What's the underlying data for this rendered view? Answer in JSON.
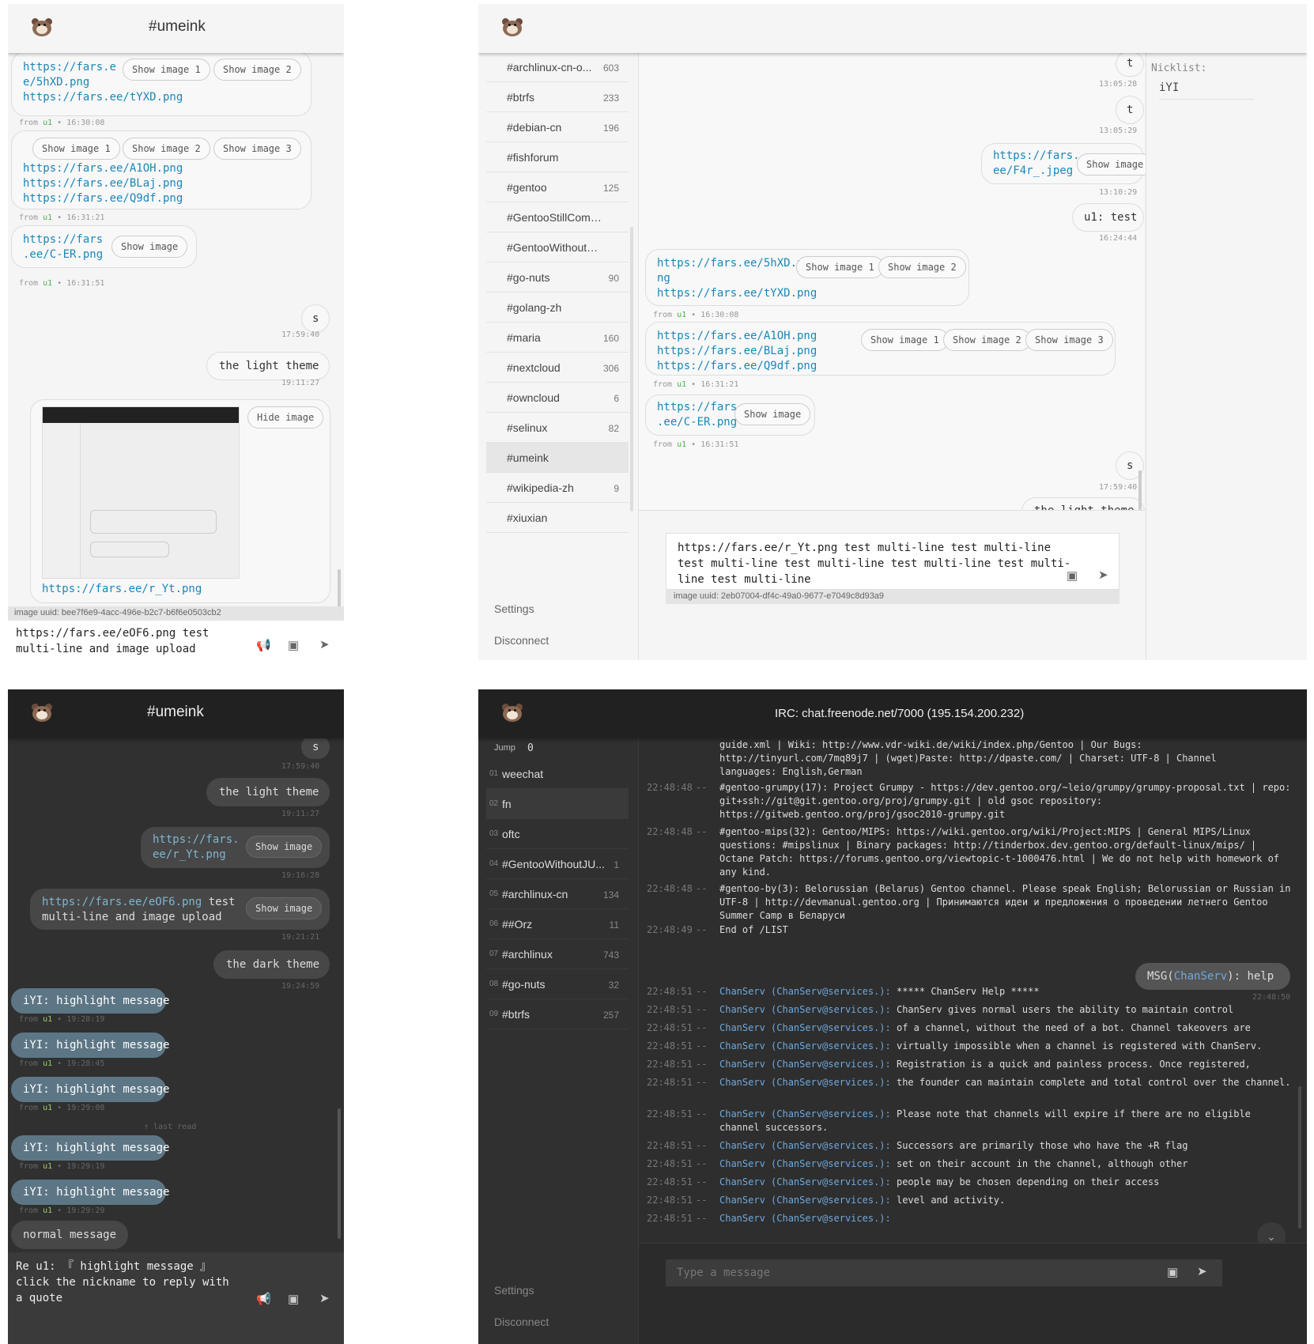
{
  "light_mobile": {
    "title": "#umeink",
    "msg1": {
      "link1": "https://fars.e",
      "link1b": "e/5hXD.png",
      "link2": "https://fars.ee/tYXD.png",
      "btn1": "Show image 1",
      "btn2": "Show image 2",
      "from": "u1",
      "time": "16:30:08"
    },
    "msg2": {
      "link1": "https://fars.ee/A1OH.png",
      "link2": "https://fars.ee/BLaj.png",
      "link3": "https://fars.ee/Q9df.png",
      "btn1": "Show image 1",
      "btn2": "Show image 2",
      "btn3": "Show image 3",
      "from": "u1",
      "time": "16:31:21"
    },
    "msg3": {
      "link1": "https://fars",
      "link1b": ".ee/C-ER.png",
      "btn": "Show image",
      "from": "u1",
      "time": "16:31:51"
    },
    "msg4": {
      "text": "s",
      "time": "17:59:40"
    },
    "msg5": {
      "text": "the light theme",
      "time": "19:11:27"
    },
    "msg6": {
      "btn": "Hide image",
      "link": "https://fars.ee/r_Yt.png"
    },
    "upload_status": "image uuid: bee7f6e9-4acc-496e-b2c7-b6f6e0503cb2",
    "input_line1": "https://fars.ee/eOF6.png test",
    "input_line2": "multi-line and image upload"
  },
  "light_desktop": {
    "channels": [
      {
        "name": "#archlinux-cn-o...",
        "count": "603"
      },
      {
        "name": "#btrfs",
        "count": "233"
      },
      {
        "name": "#debian-cn",
        "count": "196"
      },
      {
        "name": "#fishforum",
        "count": ""
      },
      {
        "name": "#gentoo",
        "count": "125"
      },
      {
        "name": "#GentooStillCompili...",
        "count": ""
      },
      {
        "name": "#GentooWithoutJUJU",
        "count": ""
      },
      {
        "name": "#go-nuts",
        "count": "90"
      },
      {
        "name": "#golang-zh",
        "count": ""
      },
      {
        "name": "#maria",
        "count": "160"
      },
      {
        "name": "#nextcloud",
        "count": "306"
      },
      {
        "name": "#owncloud",
        "count": "6"
      },
      {
        "name": "#selinux",
        "count": "82"
      },
      {
        "name": "#umeink",
        "count": ""
      },
      {
        "name": "#wikipedia-zh",
        "count": "9"
      },
      {
        "name": "#xiuxian",
        "count": ""
      }
    ],
    "settings": "Settings",
    "disconnect": "Disconnect",
    "nicklist_label": "Nicklist:",
    "nick": "iYI",
    "m_t1": {
      "text": "t",
      "time": "13:05:28"
    },
    "m_t2": {
      "text": "t",
      "time": "13:05:29"
    },
    "m_img": {
      "link1": "https://fars.",
      "link1b": "ee/F4r_.jpeg",
      "btn": "Show image",
      "time": "13:10:29"
    },
    "m_test": {
      "text": "u1: test",
      "time": "16:24:44"
    },
    "m_a": {
      "link1": "https://fars.ee/5hXD.p",
      "link1b": "ng",
      "link2": "https://fars.ee/tYXD.png",
      "btn1": "Show image 1",
      "btn2": "Show image 2",
      "from": "u1",
      "time": "16:30:08"
    },
    "m_b": {
      "link1": "https://fars.ee/A1OH.png",
      "link2": "https://fars.ee/BLaj.png",
      "link3": "https://fars.ee/Q9df.png",
      "btn1": "Show image 1",
      "btn2": "Show image 2",
      "btn3": "Show image 3",
      "from": "u1",
      "time": "16:31:21"
    },
    "m_c": {
      "link1": "https://fars",
      "link1b": ".ee/C-ER.png",
      "btn": "Show image",
      "from": "u1",
      "time": "16:31:51"
    },
    "m_s": {
      "text": "s",
      "time": "17:59:40"
    },
    "m_light": {
      "text": "the light theme"
    },
    "input_line1": "https://fars.ee/r_Yt.png test multi-line test multi-line",
    "input_line2": "test multi-line test multi-line test multi-line test multi-",
    "input_line3": "line test multi-line",
    "upload_status": "image uuid: 2eb07004-df4c-49a0-9677-e7049c8d93a9"
  },
  "dark_mobile": {
    "title": "#umeink",
    "m_s": {
      "text": "s",
      "time": "17:59:40"
    },
    "m_light": {
      "text": "the light theme",
      "time": "19:11:27"
    },
    "m_img": {
      "link1": "https://fars.",
      "link1b": "ee/r_Yt.png",
      "btn": "Show image",
      "time": "19:16:28"
    },
    "m_multi": {
      "link": "https://fars.ee/eOF6.png",
      "text1": " test",
      "text2": "multi-line and image upload",
      "btn": "Show image",
      "time": "19:21:21"
    },
    "m_dark": {
      "text": "the dark theme",
      "time": "19:24:59"
    },
    "highlights": [
      {
        "text": "iYI: highlight message",
        "from": "u1",
        "time": "19:28:19"
      },
      {
        "text": "iYI: highlight message",
        "from": "u1",
        "time": "19:28:45"
      },
      {
        "text": "iYI: highlight message",
        "from": "u1",
        "time": "19:29:08"
      },
      {
        "text": "iYI: highlight message",
        "from": "u1",
        "time": "19:29:19"
      },
      {
        "text": "iYI: highlight message",
        "from": "u1",
        "time": "19:29:29"
      }
    ],
    "last_read": "↑ last read",
    "normal": "normal message",
    "input_line1": "Re u1: 『 highlight message 』",
    "input_line2": "click the nickname to reply with",
    "input_line3": "a quote"
  },
  "dark_desktop": {
    "title": "IRC: chat.freenode.net/7000 (195.154.200.232)",
    "jump_label": "Jump",
    "jump_value": "0",
    "buffers": [
      {
        "no": "01",
        "name": "weechat",
        "count": ""
      },
      {
        "no": "02",
        "name": "fn",
        "count": ""
      },
      {
        "no": "03",
        "name": "oftc",
        "count": ""
      },
      {
        "no": "04",
        "name": "#GentooWithoutJU...",
        "count": "1"
      },
      {
        "no": "05",
        "name": "#archlinux-cn",
        "count": "134"
      },
      {
        "no": "06",
        "name": "##Orz",
        "count": "11"
      },
      {
        "no": "07",
        "name": "#archlinux",
        "count": "743"
      },
      {
        "no": "08",
        "name": "#go-nuts",
        "count": "32"
      },
      {
        "no": "09",
        "name": "#btrfs",
        "count": "257"
      }
    ],
    "settings": "Settings",
    "disconnect": "Disconnect",
    "top_lines": {
      "l1": "guide.xml | Wiki: http://www.vdr-wiki.de/wiki/index.php/Gentoo | Our Bugs:",
      "l2": "http://tinyurl.com/7mq89j7 | (wget)Paste: http://dpaste.com/ | Charset: UTF-8 | Channel",
      "l3": "languages: English,German"
    },
    "log": [
      {
        "time": "22:48:48",
        "dash": "--",
        "text": "#gentoo-grumpy(17): Project Grumpy - https://dev.gentoo.org/~leio/grumpy/grumpy-proposal.txt | repo: git+ssh://git@git.gentoo.org/proj/grumpy.git | old gsoc repository: https://gitweb.gentoo.org/proj/gsoc2010-grumpy.git"
      },
      {
        "time": "22:48:48",
        "dash": "--",
        "text": "#gentoo-mips(32): Gentoo/MIPS: https://wiki.gentoo.org/wiki/Project:MIPS | General MIPS/Linux questions: #mipslinux | Binary packages: http://tinderbox.dev.gentoo.org/default-linux/mips/ | Octane Patch: https://forums.gentoo.org/viewtopic-t-1000476.html | We do not help with homework of any kind."
      },
      {
        "time": "22:48:48",
        "dash": "--",
        "text": "#gentoo-by(3): Belorussian (Belarus) Gentoo channel. Please speak English; Belorussian or Russian in UTF-8 | http://devmanual.gentoo.org | Принимаются идеи и предложения о проведении летнего Gentoo Summer Camp в Беларуси"
      },
      {
        "time": "22:48:49",
        "dash": "--",
        "text": "End of /LIST"
      }
    ],
    "own_msg": {
      "prefix": "MSG(",
      "nick": "ChanServ",
      "suffix": "): help",
      "time": "22:48:50"
    },
    "chanserv_lines": [
      {
        "time": "22:48:51",
        "text": "***** ChanServ Help *****"
      },
      {
        "time": "22:48:51",
        "text": "ChanServ gives normal users the ability to maintain control"
      },
      {
        "time": "22:48:51",
        "text": "of a channel, without the need of a bot. Channel takeovers are"
      },
      {
        "time": "22:48:51",
        "text": "virtually impossible when a channel is registered with ChanServ."
      },
      {
        "time": "22:48:51",
        "text": "Registration is a quick and painless process. Once registered,"
      },
      {
        "time": "22:48:51",
        "text": "the founder can maintain complete and total control over the channel."
      },
      {
        "time": "22:48:51",
        "text": "Please note that channels will expire if there are no eligible channel successors."
      },
      {
        "time": "22:48:51",
        "text": "Successors are primarily those who have the +R flag"
      },
      {
        "time": "22:48:51",
        "text": "set on their account in the channel, although other"
      },
      {
        "time": "22:48:51",
        "text": "people may be chosen depending on their access"
      },
      {
        "time": "22:48:51",
        "text": "level and activity."
      },
      {
        "time": "22:48:51",
        "text": ""
      }
    ],
    "cs_nick": "ChanServ",
    "cs_host": "(ChanServ@services.):",
    "placeholder": "Type a message"
  },
  "colors": {
    "link": "#1b86b8",
    "nick_green": "#4caf50",
    "highlight": "#5d7685",
    "dark_bg": "#303030"
  },
  "icons": [
    "bear-logo-icon",
    "megaphone-icon",
    "image-icon",
    "send-icon",
    "chevron-down-icon"
  ]
}
